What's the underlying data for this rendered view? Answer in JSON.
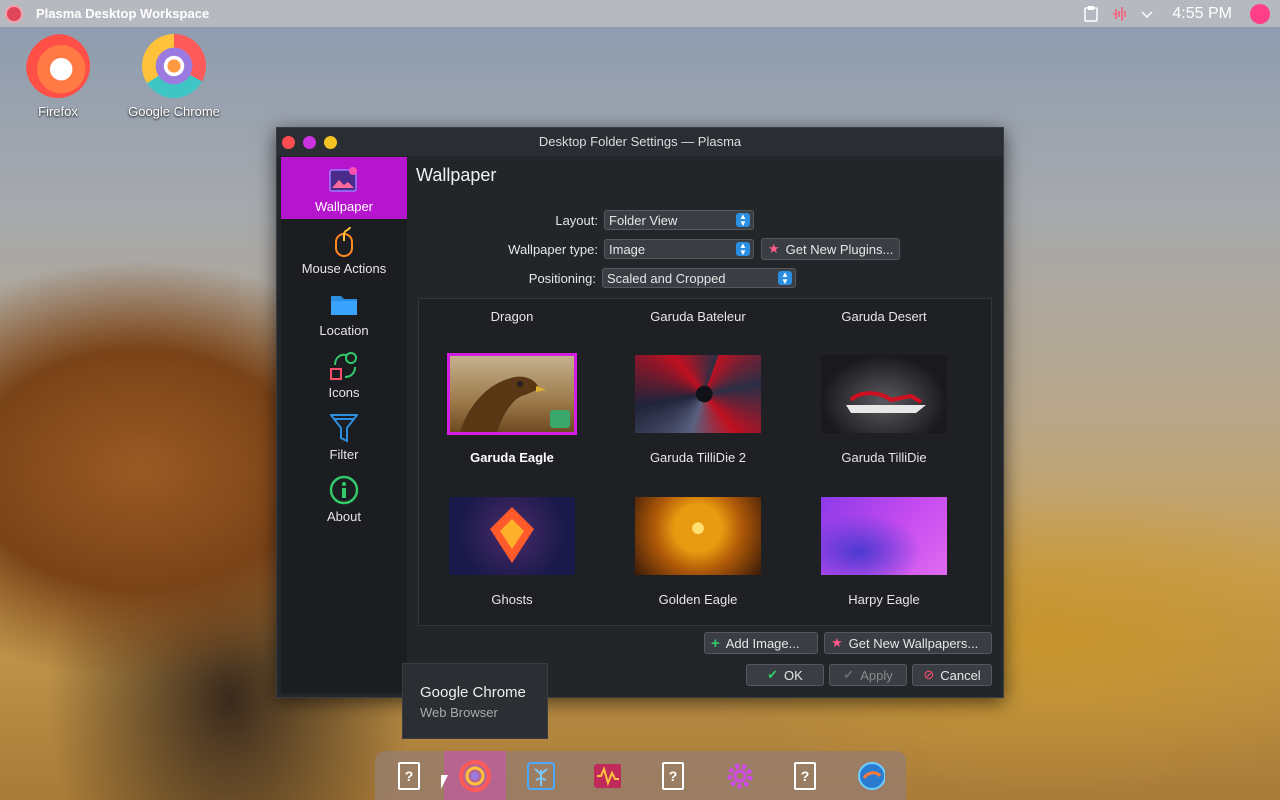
{
  "top_panel": {
    "title": "Plasma Desktop Workspace",
    "clock": "4:55 PM"
  },
  "desktop": {
    "icons": [
      {
        "label": "Firefox"
      },
      {
        "label": "Google Chrome"
      }
    ]
  },
  "window": {
    "title": "Desktop Folder Settings — Plasma",
    "sidebar": {
      "items": [
        {
          "label": "Wallpaper",
          "icon": "wallpaper-icon"
        },
        {
          "label": "Mouse Actions",
          "icon": "mouse-icon"
        },
        {
          "label": "Location",
          "icon": "folder-icon"
        },
        {
          "label": "Icons",
          "icon": "shapes-icon"
        },
        {
          "label": "Filter",
          "icon": "filter-icon"
        },
        {
          "label": "About",
          "icon": "info-icon"
        }
      ]
    },
    "page_title": "Wallpaper",
    "form": {
      "layout_label": "Layout:",
      "layout_value": "Folder View",
      "type_label": "Wallpaper type:",
      "type_value": "Image",
      "get_plugins": "Get New Plugins...",
      "positioning_label": "Positioning:",
      "positioning_value": "Scaled and Cropped"
    },
    "wallpapers": {
      "top_row": [
        "Dragon",
        "Garuda Bateleur",
        "Garuda Desert"
      ],
      "items": [
        {
          "name": "Garuda Eagle",
          "selected": true
        },
        {
          "name": "Garuda TilliDie 2",
          "selected": false
        },
        {
          "name": "Garuda TilliDie",
          "selected": false
        },
        {
          "name": "Ghosts",
          "selected": false
        },
        {
          "name": "Golden Eagle",
          "selected": false
        },
        {
          "name": "Harpy Eagle",
          "selected": false
        }
      ]
    },
    "buttons": {
      "add_image": "Add Image...",
      "get_wallpapers": "Get New Wallpapers...",
      "ok": "OK",
      "apply": "Apply",
      "cancel": "Cancel"
    }
  },
  "tooltip": {
    "title": "Google Chrome",
    "subtitle": "Web Browser"
  },
  "dock": {
    "items": [
      "unknown-app-icon",
      "chrome-icon",
      "tree-app-icon",
      "audio-app-icon",
      "unknown-app-icon",
      "settings-gear-icon",
      "unknown-app-icon",
      "garuda-icon"
    ]
  }
}
